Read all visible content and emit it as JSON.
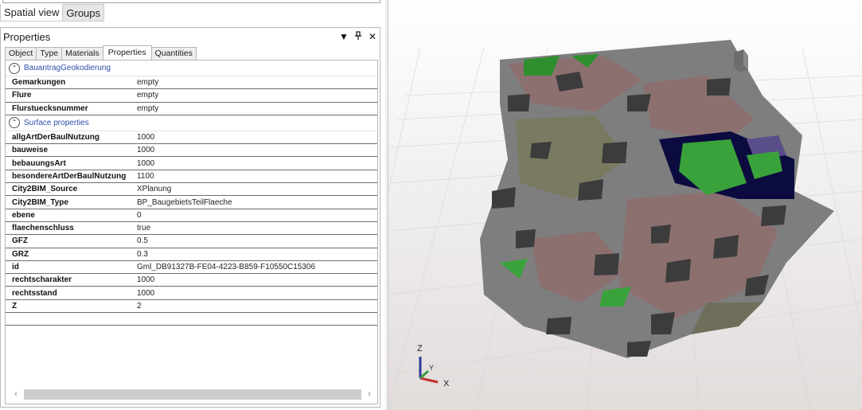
{
  "view_tabs": [
    "Spatial view",
    "Groups"
  ],
  "properties_panel": {
    "title": "Properties",
    "menu_icon": "triangle-down",
    "pin_icon": "pin",
    "close_icon": "close-x",
    "tabs": [
      "Object",
      "Type",
      "Materials",
      "Properties",
      "Quantities"
    ],
    "active_tab": "Properties",
    "categories": [
      {
        "label": "BauantragGeokodierung",
        "rows": [
          {
            "name": "Gemarkungen",
            "value": "empty"
          },
          {
            "name": "Flure",
            "value": "empty"
          },
          {
            "name": "Flurstuecksnummer",
            "value": "empty"
          }
        ]
      },
      {
        "label": "Surface properties",
        "rows": [
          {
            "name": "allgArtDerBaulNutzung",
            "value": "1000"
          },
          {
            "name": "bauweise",
            "value": "1000"
          },
          {
            "name": "bebauungsArt",
            "value": "1000"
          },
          {
            "name": "besondereArtDerBaulNutzung",
            "value": "1100"
          },
          {
            "name": "City2BIM_Source",
            "value": "XPlanung"
          },
          {
            "name": "City2BIM_Type",
            "value": "BP_BaugebietsTeilFlaeche"
          },
          {
            "name": "ebene",
            "value": "0"
          },
          {
            "name": "flaechenschluss",
            "value": "true"
          },
          {
            "name": "GFZ",
            "value": "0.5"
          },
          {
            "name": "GRZ",
            "value": "0.3"
          },
          {
            "name": "id",
            "value": "Gml_DB91327B-FE04-4223-B859-F10550C15306"
          },
          {
            "name": "rechtscharakter",
            "value": "1000"
          },
          {
            "name": "rechtsstand",
            "value": "1000"
          },
          {
            "name": "Z",
            "value": "2"
          }
        ]
      }
    ]
  },
  "viewport": {
    "axis_labels": {
      "z": "Z",
      "y": "Y",
      "x": "X"
    },
    "colors": {
      "surface_gray": "#7e7e7e",
      "dark_patch": "#3c3c3c",
      "pink_patch": "#8c7070",
      "green_patch": "#3aa23a",
      "navy_patch": "#0b0b40",
      "olive_patch": "#7a7a62"
    }
  }
}
